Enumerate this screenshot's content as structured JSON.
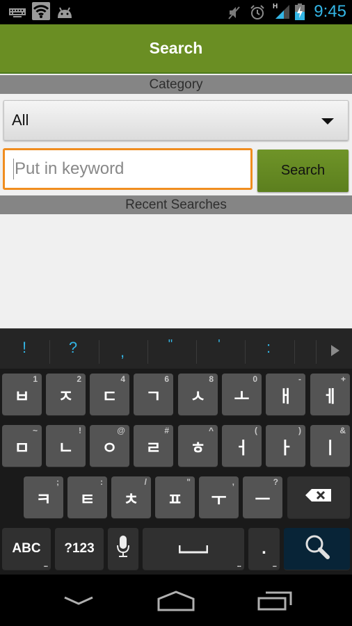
{
  "status_bar": {
    "left_icons": [
      "keyboard-icon",
      "wifi-icon",
      "android-icon"
    ],
    "right_icons": [
      "muted-icon",
      "alarm-icon",
      "signal-h-icon",
      "battery-charging-icon"
    ],
    "signal_label": "H",
    "time": "9:45",
    "time_color": "#33b5e5"
  },
  "action_bar": {
    "title": "Search",
    "color": "#6a8e23"
  },
  "category": {
    "header": "Category",
    "selected": "All"
  },
  "search": {
    "placeholder": "Put in keyword",
    "value": "",
    "button_label": "Search",
    "focus_color": "#f08d1f"
  },
  "recent": {
    "header": "Recent Searches",
    "items": []
  },
  "keyboard": {
    "suggestions": [
      "!",
      "?",
      ",",
      "\"",
      "'",
      ":"
    ],
    "row1": [
      {
        "label": "ㅂ",
        "hint": "1"
      },
      {
        "label": "ㅈ",
        "hint": "2"
      },
      {
        "label": "ㄷ",
        "hint": "4"
      },
      {
        "label": "ㄱ",
        "hint": "6"
      },
      {
        "label": "ㅅ",
        "hint": "8"
      },
      {
        "label": "ㅗ",
        "hint": "0"
      },
      {
        "label": "ㅐ",
        "hint": "-"
      },
      {
        "label": "ㅔ",
        "hint": "+"
      }
    ],
    "row2": [
      {
        "label": "ㅁ",
        "hint": "~"
      },
      {
        "label": "ㄴ",
        "hint": "!"
      },
      {
        "label": "ㅇ",
        "hint": "@"
      },
      {
        "label": "ㄹ",
        "hint": "#"
      },
      {
        "label": "ㅎ",
        "hint": "^"
      },
      {
        "label": "ㅓ",
        "hint": "("
      },
      {
        "label": "ㅏ",
        "hint": ")"
      },
      {
        "label": "ㅣ",
        "hint": "&"
      }
    ],
    "row3": [
      {
        "label": "ㅋ",
        "hint": ";"
      },
      {
        "label": "ㅌ",
        "hint": ":"
      },
      {
        "label": "ㅊ",
        "hint": "/"
      },
      {
        "label": "ㅍ",
        "hint": "\""
      },
      {
        "label": "ㅜ",
        "hint": ","
      },
      {
        "label": "ㅡ",
        "hint": "?"
      }
    ],
    "abc_label": "ABC",
    "sym_label": "?123",
    "period_label": ".",
    "more_dots": "..."
  },
  "nav_bar": {
    "buttons": [
      "back-icon",
      "home-icon",
      "recents-icon"
    ]
  }
}
